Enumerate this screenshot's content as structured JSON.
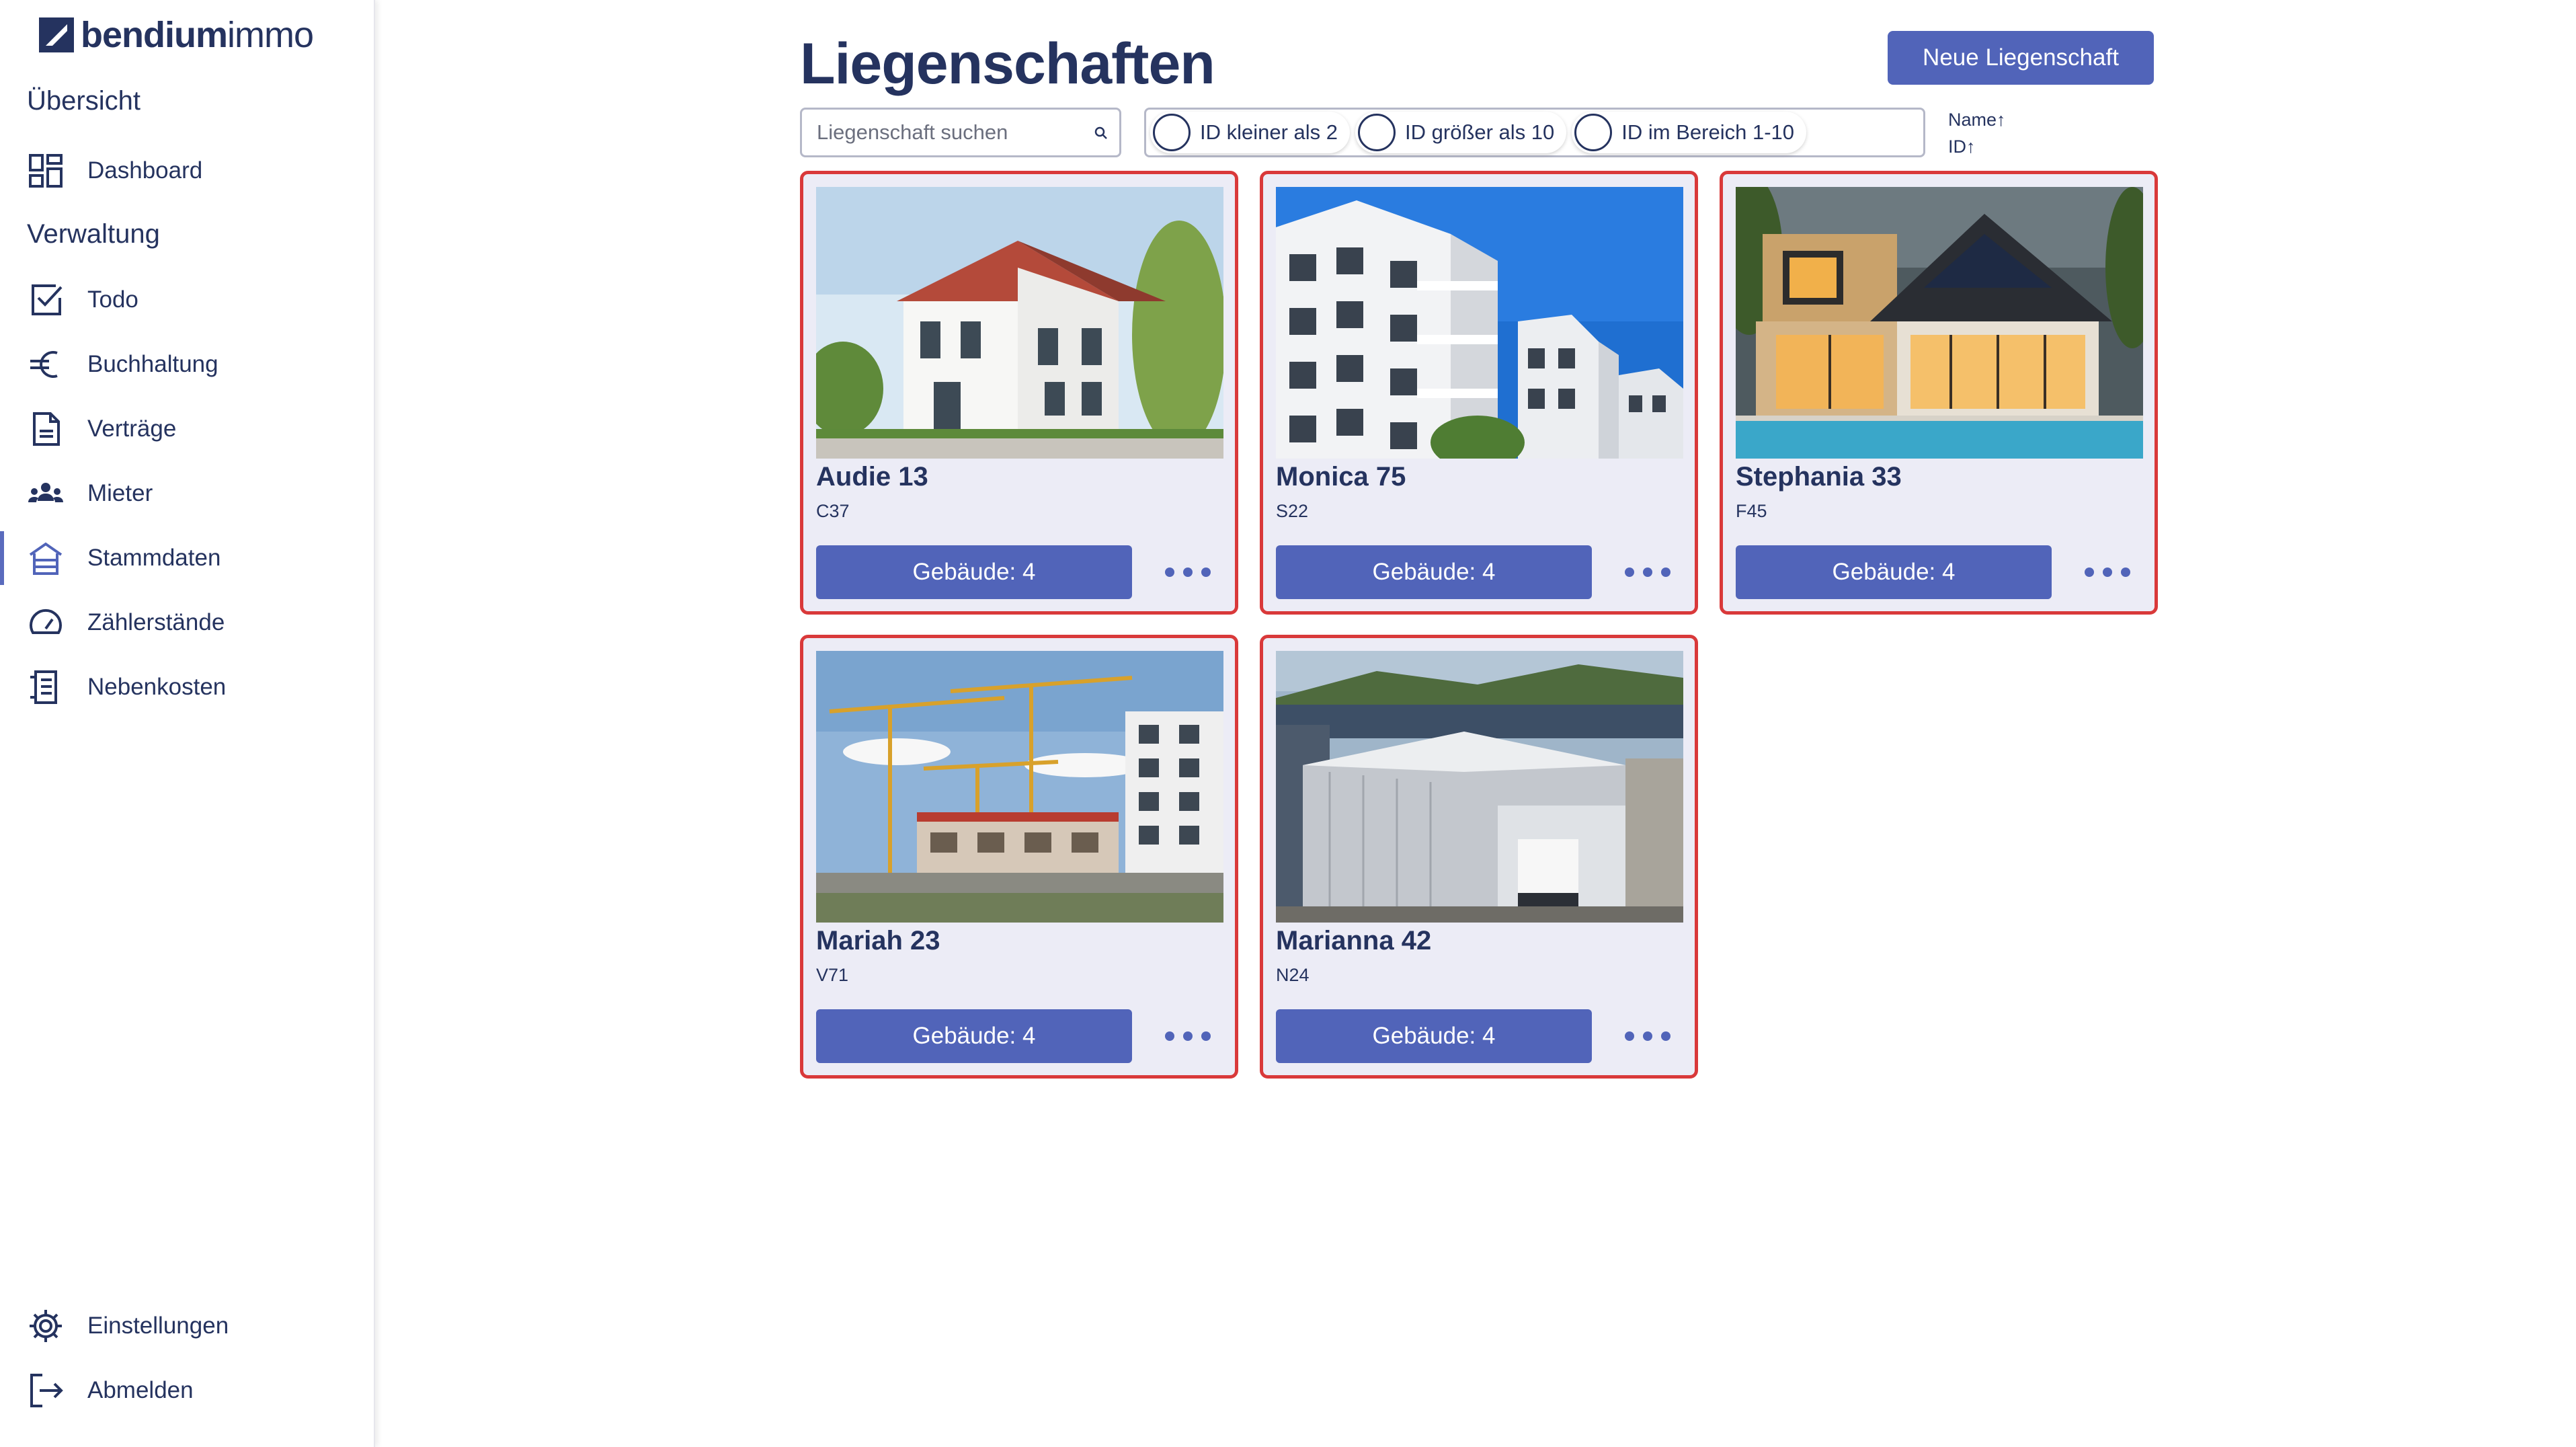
{
  "app": {
    "logo_bold": "bendium",
    "logo_light": "immo"
  },
  "sidebar": {
    "section_overview": "Übersicht",
    "section_admin": "Verwaltung",
    "items": [
      {
        "label": "Dashboard",
        "icon": "dashboard-icon"
      },
      {
        "label": "Todo",
        "icon": "checkbox-icon"
      },
      {
        "label": "Buchhaltung",
        "icon": "euro-icon"
      },
      {
        "label": "Verträge",
        "icon": "document-icon"
      },
      {
        "label": "Mieter",
        "icon": "people-icon"
      },
      {
        "label": "Stammdaten",
        "icon": "house-icon",
        "active": true
      },
      {
        "label": "Zählerstände",
        "icon": "gauge-icon"
      },
      {
        "label": "Nebenkosten",
        "icon": "receipt-icon"
      }
    ],
    "footer": [
      {
        "label": "Einstellungen",
        "icon": "gear-icon"
      },
      {
        "label": "Abmelden",
        "icon": "logout-icon"
      }
    ]
  },
  "main": {
    "title": "Liegenschaften",
    "new_button": "Neue Liegenschaft",
    "search_placeholder": "Liegenschaft suchen",
    "filters": [
      "ID kleiner als 2",
      "ID größer als 10",
      "ID im Bereich 1-10"
    ],
    "sort": [
      "Name↑",
      "ID↑"
    ]
  },
  "properties": [
    {
      "name": "Audie 13",
      "code": "C37",
      "buildings": "Gebäude: 4",
      "image": "white-house"
    },
    {
      "name": "Monica 75",
      "code": "S22",
      "buildings": "Gebäude: 4",
      "image": "apartment-block"
    },
    {
      "name": "Stephania 33",
      "code": "F45",
      "buildings": "Gebäude: 4",
      "image": "modern-villa"
    },
    {
      "name": "Mariah 23",
      "code": "V71",
      "buildings": "Gebäude: 4",
      "image": "construction-site"
    },
    {
      "name": "Marianna 42",
      "code": "N24",
      "buildings": "Gebäude: 4",
      "image": "warehouse"
    }
  ],
  "colors": {
    "primary": "#5164b9",
    "text": "#25335f",
    "card_border": "#d9393a",
    "card_bg": "#ececf6"
  }
}
